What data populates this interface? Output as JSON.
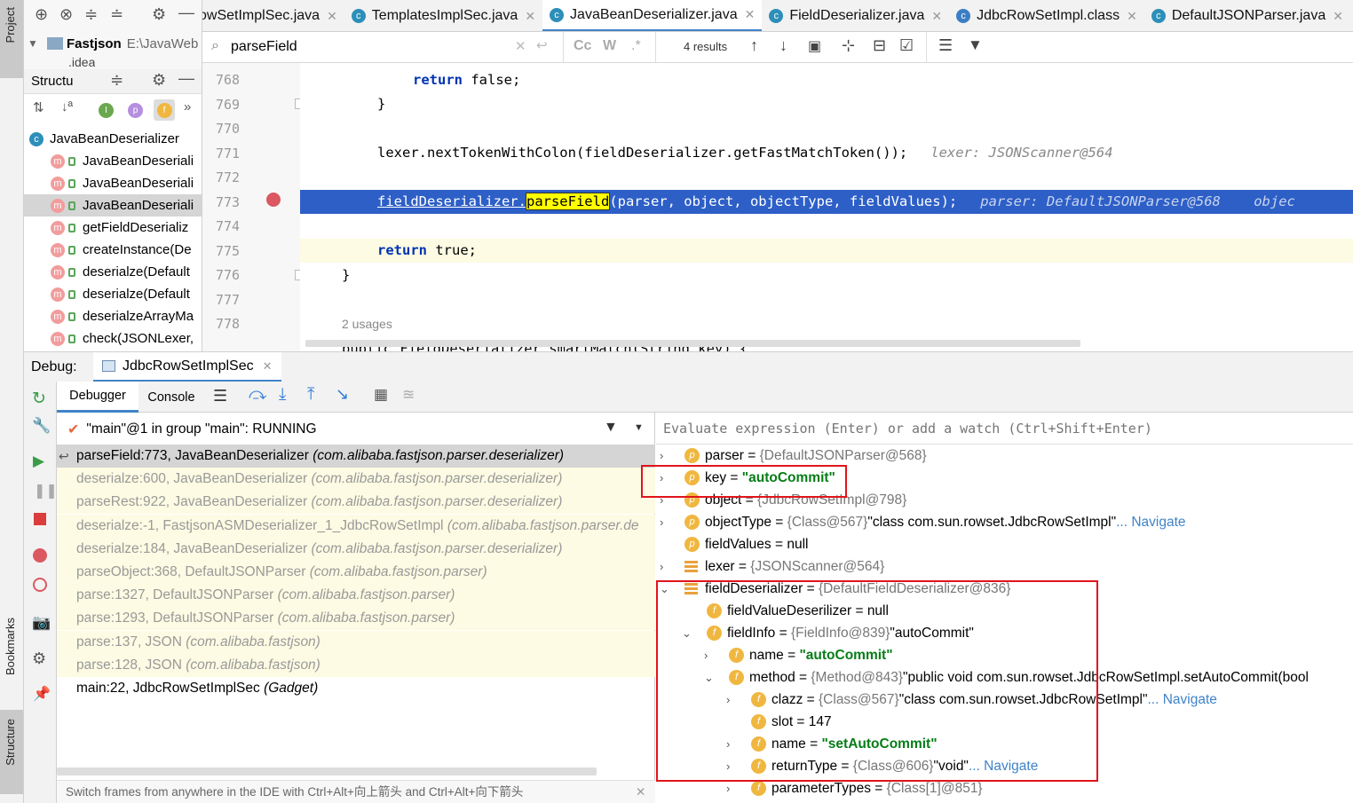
{
  "project_panel": {
    "stripe_label": "Project",
    "root_name": "Fastjson",
    "root_path": "E:\\JavaWeb",
    "child": ".idea"
  },
  "structure_panel": {
    "title": "Structu",
    "root": "JavaBeanDeserializer",
    "items": [
      "JavaBeanDeseriali",
      "JavaBeanDeseriali",
      "JavaBeanDeseriali",
      "getFieldDeserializ",
      "createInstance(De",
      "deserialze(Default",
      "deserialze(Default",
      "deserialzeArrayMa",
      "check(JSONLexer,"
    ]
  },
  "tabs": [
    {
      "label": "owSetImplSec.java",
      "active": false
    },
    {
      "label": "TemplatesImplSec.java",
      "active": false
    },
    {
      "label": "JavaBeanDeserializer.java",
      "active": true
    },
    {
      "label": "FieldDeserializer.java",
      "active": false
    },
    {
      "label": "JdbcRowSetImpl.class",
      "active": false
    },
    {
      "label": "DefaultJSONParser.java",
      "active": false
    }
  ],
  "search": {
    "query": "parseField",
    "results": "4 results"
  },
  "editor": {
    "line_numbers": [
      "768",
      "769",
      "770",
      "771",
      "772",
      "773",
      "774",
      "775",
      "776",
      "777",
      "778"
    ],
    "usages": "2 usages",
    "code": {
      "l768_kw": "return",
      "l768_rest": " false;",
      "l769": "}",
      "l771_code": "lexer.nextTokenWithColon(fieldDeserializer.getFastMatchToken());",
      "l771_hint": "lexer: JSONScanner@564",
      "l773_pre": "fieldDeserializer.",
      "l773_hl": "parseField",
      "l773_post": "(parser, object, objectType, fieldValues);",
      "l773_hint": "parser: DefaultJSONParser@568    objec",
      "l775_kw": "return",
      "l775_rest": " true;",
      "l776": "}",
      "l778": "public FieldDeserializer smartMatch(String key) {"
    }
  },
  "debug": {
    "title": "Debug:",
    "session": "JdbcRowSetImplSec",
    "tab_debugger": "Debugger",
    "tab_console": "Console",
    "bookmarks_label": "Bookmarks",
    "structure_label": "Structure",
    "thread": "\"main\"@1 in group \"main\": RUNNING",
    "eval_placeholder": "Evaluate expression (Enter) or add a watch (Ctrl+Shift+Enter)",
    "footer_hint": "Switch frames from anywhere in the IDE with Ctrl+Alt+向上箭头 and Ctrl+Alt+向下箭头",
    "frames": [
      {
        "method": "parseField:773, JavaBeanDeserializer",
        "pkg": "(com.alibaba.fastjson.parser.deserializer)",
        "state": "current"
      },
      {
        "method": "deserialze:600, JavaBeanDeserializer",
        "pkg": "(com.alibaba.fastjson.parser.deserializer)",
        "state": "lib"
      },
      {
        "method": "parseRest:922, JavaBeanDeserializer",
        "pkg": "(com.alibaba.fastjson.parser.deserializer)",
        "state": "lib"
      },
      {
        "method": "deserialze:-1, FastjsonASMDeserializer_1_JdbcRowSetImpl",
        "pkg": "(com.alibaba.fastjson.parser.de",
        "state": "lib"
      },
      {
        "method": "deserialze:184, JavaBeanDeserializer",
        "pkg": "(com.alibaba.fastjson.parser.deserializer)",
        "state": "lib"
      },
      {
        "method": "parseObject:368, DefaultJSONParser",
        "pkg": "(com.alibaba.fastjson.parser)",
        "state": "lib"
      },
      {
        "method": "parse:1327, DefaultJSONParser",
        "pkg": "(com.alibaba.fastjson.parser)",
        "state": "lib"
      },
      {
        "method": "parse:1293, DefaultJSONParser",
        "pkg": "(com.alibaba.fastjson.parser)",
        "state": "lib"
      },
      {
        "method": "parse:137, JSON",
        "pkg": "(com.alibaba.fastjson)",
        "state": "lib"
      },
      {
        "method": "parse:128, JSON",
        "pkg": "(com.alibaba.fastjson)",
        "state": "lib"
      },
      {
        "method": "main:22, JdbcRowSetImplSec",
        "pkg": "(Gadget)",
        "state": "user"
      }
    ],
    "variables": {
      "parser": {
        "name": "parser",
        "val": "{DefaultJSONParser@568}"
      },
      "key": {
        "name": "key",
        "val": "\"autoCommit\""
      },
      "object": {
        "name": "object",
        "val": "{JdbcRowSetImpl@798}"
      },
      "objectType": {
        "name": "objectType",
        "val": "{Class@567}",
        "str": "\"class com.sun.rowset.JdbcRowSetImpl\"",
        "nav": "... Navigate"
      },
      "fieldValues": {
        "name": "fieldValues",
        "val": "null"
      },
      "lexer": {
        "name": "lexer",
        "val": "{JSONScanner@564}"
      },
      "fieldDeserializer": {
        "name": "fieldDeserializer",
        "val": "{DefaultFieldDeserializer@836}"
      },
      "fieldValueDeserilizer": {
        "name": "fieldValueDeserilizer",
        "val": "null"
      },
      "fieldInfo": {
        "name": "fieldInfo",
        "val": "{FieldInfo@839}",
        "str": "\"autoCommit\""
      },
      "fi_name": {
        "name": "name",
        "val": "\"autoCommit\""
      },
      "method": {
        "name": "method",
        "val": "{Method@843}",
        "str": "\"public void com.sun.rowset.JdbcRowSetImpl.setAutoCommit(bool"
      },
      "clazz": {
        "name": "clazz",
        "val": "{Class@567}",
        "str": "\"class com.sun.rowset.JdbcRowSetImpl\"",
        "nav": "... Navigate"
      },
      "slot": {
        "name": "slot",
        "val": "147"
      },
      "m_name": {
        "name": "name",
        "val": "\"setAutoCommit\""
      },
      "returnType": {
        "name": "returnType",
        "val": "{Class@606}",
        "str": "\"void\"",
        "nav": "... Navigate"
      },
      "parameterTypes": {
        "name": "parameterTypes",
        "val": "{Class[1]@851}"
      }
    }
  },
  "colors": {
    "highlight_line": "#2d5fc7",
    "frames_lib_bg": "#fdfbe3",
    "string_green": "#067d17",
    "annotation_red": "#e0151b",
    "accent_blue": "#4083c9"
  }
}
